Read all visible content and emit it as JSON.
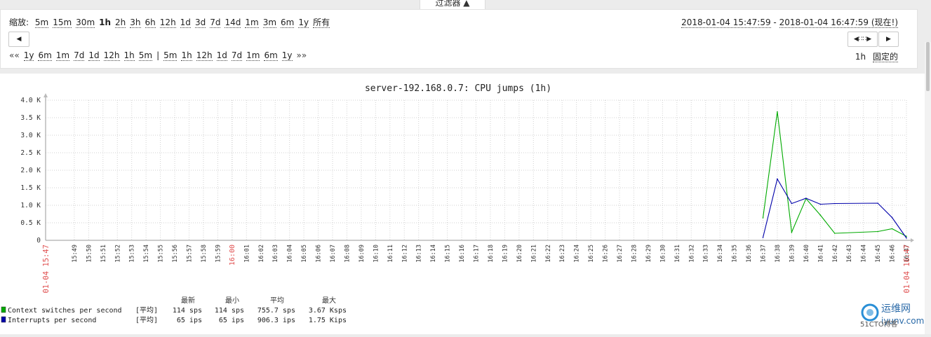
{
  "filter_tab": {
    "label": "过滤器 ▲"
  },
  "zoom": {
    "label": "缩放:",
    "options": [
      "5m",
      "15m",
      "30m",
      "1h",
      "2h",
      "3h",
      "6h",
      "12h",
      "1d",
      "3d",
      "7d",
      "14d",
      "1m",
      "3m",
      "6m",
      "1y",
      "所有"
    ],
    "active": "1h"
  },
  "period": {
    "from": "2018-01-04 15:47:59",
    "separator": " - ",
    "to": "2018-01-04 16:47:59 (现在!)"
  },
  "nav": {
    "back_icon": "caret-left-icon",
    "forward_icon": "caret-right-icon",
    "slider_icon": "period-slider-icon",
    "back_arrows": "««",
    "back_options": [
      "1y",
      "6m",
      "1m",
      "7d",
      "1d",
      "12h",
      "1h",
      "5m"
    ],
    "separator": "|",
    "forward_options": [
      "5m",
      "1h",
      "12h",
      "1d",
      "7d",
      "1m",
      "6m",
      "1y"
    ],
    "forward_arrows": "»»",
    "period_label": "1h",
    "fixed_label": "固定的"
  },
  "colors": {
    "series1": "#00aa00",
    "series2": "#0000aa",
    "highlight": "#e05050",
    "grid": "#cfcfcf"
  },
  "chart_data": {
    "type": "line",
    "title": "server-192.168.0.7: CPU jumps (1h)",
    "ylim": [
      0,
      4000
    ],
    "yticks": [
      0,
      500,
      1000,
      1500,
      2000,
      2500,
      3000,
      3500,
      4000
    ],
    "ytick_labels": [
      "0",
      "0.5 K",
      "1.0 K",
      "1.5 K",
      "2.0 K",
      "2.5 K",
      "3.0 K",
      "3.5 K",
      "4.0 K"
    ],
    "x_start_label": "01-04 15:47",
    "x_end_label": "01-04 16:47",
    "x_major_label": "16:00",
    "xtick_labels": [
      "15:49",
      "15:50",
      "15:51",
      "15:52",
      "15:53",
      "15:54",
      "15:55",
      "15:56",
      "15:57",
      "15:58",
      "15:59",
      "16:00",
      "16:01",
      "16:02",
      "16:03",
      "16:04",
      "16:05",
      "16:06",
      "16:07",
      "16:08",
      "16:09",
      "16:10",
      "16:11",
      "16:12",
      "16:13",
      "16:14",
      "16:15",
      "16:16",
      "16:17",
      "16:18",
      "16:19",
      "16:20",
      "16:21",
      "16:22",
      "16:23",
      "16:24",
      "16:25",
      "16:26",
      "16:27",
      "16:28",
      "16:29",
      "16:30",
      "16:31",
      "16:32",
      "16:33",
      "16:34",
      "16:35",
      "16:36",
      "16:37",
      "16:38",
      "16:39",
      "16:40",
      "16:41",
      "16:42",
      "16:43",
      "16:44",
      "16:45",
      "16:46",
      "16:47"
    ],
    "x": [
      "16:37",
      "16:38",
      "16:39",
      "16:40",
      "16:41",
      "16:42",
      "16:45",
      "16:46",
      "16:47"
    ],
    "series": [
      {
        "name": "Context switches per second",
        "color": "#00aa00",
        "values": [
          640,
          3670,
          230,
          1190,
          720,
          200,
          250,
          330,
          114
        ]
      },
      {
        "name": "Interrupts per second",
        "color": "#0000aa",
        "values": [
          80,
          1750,
          1050,
          1200,
          1030,
          1050,
          1060,
          650,
          65
        ]
      }
    ],
    "grid": true,
    "legend": {
      "headers": [
        "最新",
        "最小",
        "平均",
        "最大"
      ],
      "rows": [
        {
          "name": "Context switches per second",
          "func": "[平均]",
          "last": "114 sps",
          "min": "114 sps",
          "avg": "755.7 sps",
          "max": "3.67 Ksps"
        },
        {
          "name": "Interrupts per second",
          "func": "[平均]",
          "last": "65 ips",
          "min": "65 ips",
          "avg": "906.3 ips",
          "max": "1.75 Kips"
        }
      ]
    }
  },
  "watermark": {
    "brand_cn": "运维网",
    "brand_en": "iyunv.com",
    "corner_text": "©51CTO博客"
  }
}
